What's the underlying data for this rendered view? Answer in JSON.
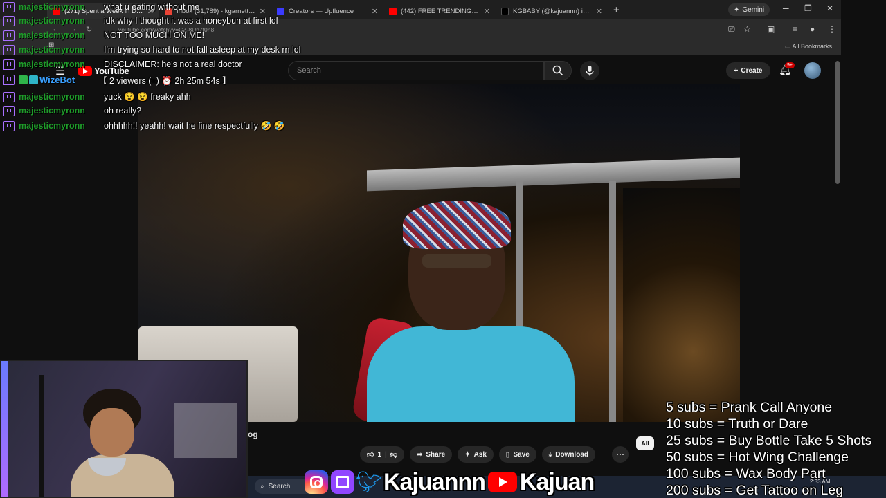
{
  "browser": {
    "tabs": [
      {
        "label": "(271) Spent a Week in Dub",
        "color": "#ff0000"
      },
      {
        "label": "Inbox (31,789) - kgarnett826@",
        "color": "#ea4335"
      },
      {
        "label": "Creators — Upfluence",
        "color": "#3b3bff"
      },
      {
        "label": "(442) FREE TRENDING NON CO",
        "color": "#ff0000"
      },
      {
        "label": "KGBABY (@kajuannn) is LIVE -",
        "color": "#000000"
      }
    ],
    "gemini_label": "Gemini",
    "address": "youtube.com/watch?v=CZ-8Un7f0h8",
    "all_bookmarks": "All Bookmarks"
  },
  "youtube": {
    "logo_text": "YouTube",
    "search_placeholder": "Search",
    "create_label": "Create",
    "notification_count": "9+"
  },
  "chat": {
    "messages": [
      {
        "user": "majesticmyronn",
        "text": "what u eating without me"
      },
      {
        "user": "majesticmyronn",
        "text": "idk why I thought it was a honeybun at first lol"
      },
      {
        "user": "majesticmyronn",
        "text": "NOT TOO MUCH ON ME!"
      },
      {
        "user": "majesticmyronn",
        "text": "I'm trying so hard to not fall asleep at my desk rn lol"
      },
      {
        "user": "majesticmyronn",
        "text": "DISCLAIMER: he's not a real doctor"
      },
      {
        "user": "WizeBot",
        "text": "【 2 viewers (=) ⏰ 2h 25m 54s 】"
      },
      {
        "user": "majesticmyronn",
        "text": "yuck 😵 😵 freaky ahh"
      },
      {
        "user": "majesticmyronn",
        "text": "oh really?"
      },
      {
        "user": "majesticmyronn",
        "text": "ohhhhh!! yeahh! wait he fine respectfully 🤣 🤣"
      }
    ]
  },
  "video_actions": {
    "like_count": "1",
    "share": "Share",
    "ask": "Ask",
    "save": "Save",
    "download": "Download",
    "all_chip": "All",
    "title_fragment": "og"
  },
  "taskbar": {
    "search": "Search",
    "time": "2:33 AM"
  },
  "social": {
    "handle_left": "Kajuannn",
    "handle_right": "Kajuan"
  },
  "sub_goals": [
    "5 subs =  Prank Call Anyone",
    "10 subs = Truth or Dare",
    "25 subs = Buy Bottle Take 5 Shots",
    "50 subs = Hot Wing Challenge",
    "100 subs = Wax Body Part",
    "200 subs = Get Tattoo on Leg"
  ]
}
